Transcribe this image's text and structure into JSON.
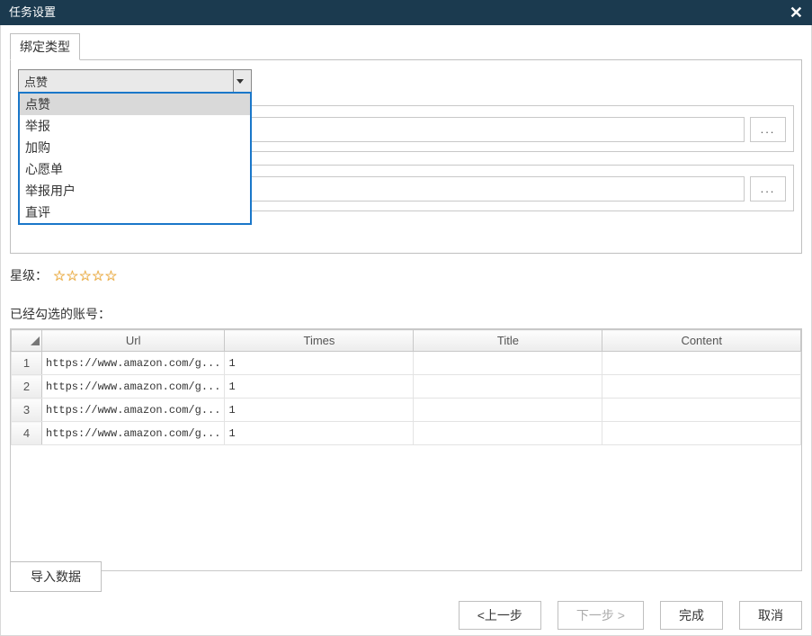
{
  "titlebar": {
    "title": "任务设置"
  },
  "tab": {
    "label": "绑定类型"
  },
  "combo": {
    "selected": "点赞",
    "options": [
      "点赞",
      "举报",
      "加购",
      "心愿单",
      "举报用户",
      "直评"
    ]
  },
  "browse_btn": "...",
  "star_label": "星级：",
  "star_count": 5,
  "selected_accounts_label": "已经勾选的账号：",
  "grid": {
    "headers": [
      "Url",
      "Times",
      "Title",
      "Content"
    ],
    "rows": [
      {
        "n": "1",
        "url": "https://www.amazon.com/g...",
        "times": "1",
        "title": "",
        "content": ""
      },
      {
        "n": "2",
        "url": "https://www.amazon.com/g...",
        "times": "1",
        "title": "",
        "content": ""
      },
      {
        "n": "3",
        "url": "https://www.amazon.com/g...",
        "times": "1",
        "title": "",
        "content": ""
      },
      {
        "n": "4",
        "url": "https://www.amazon.com/g...",
        "times": "1",
        "title": "",
        "content": ""
      }
    ]
  },
  "buttons": {
    "import": "导入数据",
    "prev": "<上一步",
    "next": "下一步 >",
    "finish": "完成",
    "cancel": "取消"
  }
}
